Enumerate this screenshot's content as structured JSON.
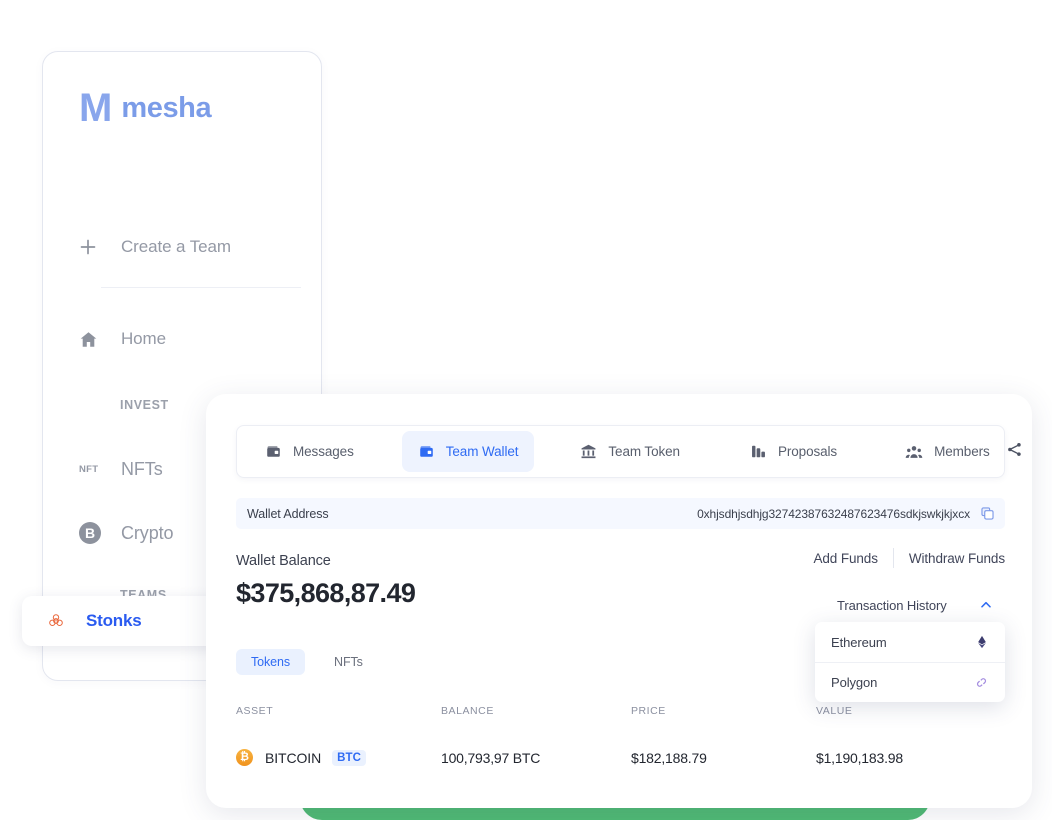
{
  "brand": {
    "mark": "M",
    "name": "mesha",
    "color": "#7b9ce8"
  },
  "sidebar": {
    "create_team": {
      "label": "Create a Team",
      "icon": "plus-icon"
    },
    "home": {
      "label": "Home",
      "icon": "home-icon"
    },
    "sections": [
      {
        "key": "invest",
        "label": "INVEST"
      },
      {
        "key": "teams",
        "label": "TEAMS"
      }
    ],
    "invest_items": [
      {
        "label": "NFTs",
        "icon": "nft-icon",
        "badge": "NFT"
      },
      {
        "label": "Crypto",
        "icon": "bitcoin-icon",
        "badge": "B"
      }
    ],
    "team_items": [
      {
        "label": "Stonks",
        "icon": "stonks-icon",
        "active": true,
        "color": "#2a5bf0"
      }
    ]
  },
  "tabs": [
    {
      "key": "messages",
      "label": "Messages",
      "icon": "wallet-icon",
      "active": false
    },
    {
      "key": "team-wallet",
      "label": "Team Wallet",
      "icon": "wallet-icon",
      "active": true
    },
    {
      "key": "team-token",
      "label": "Team Token",
      "icon": "bank-icon",
      "active": false
    },
    {
      "key": "proposals",
      "label": "Proposals",
      "icon": "proposals-icon",
      "active": false
    },
    {
      "key": "members",
      "label": "Members",
      "icon": "members-icon",
      "active": false
    }
  ],
  "share": {
    "icon": "share-icon"
  },
  "wallet": {
    "address_label": "Wallet Address",
    "address_value": "0xhjsdhjsdhjg32742387632487623476sdkjswkjkjxcx",
    "copy_icon": "copy-icon",
    "balance_label": "Wallet Balance",
    "balance_amount": "$375,868,87.49",
    "add_funds": "Add Funds",
    "withdraw_funds": "Withdraw Funds"
  },
  "transaction_history": {
    "label": "Transaction History",
    "caret": "chevron-up-icon",
    "expanded": true,
    "options": [
      {
        "label": "Ethereum",
        "icon": "ethereum-icon",
        "color": "#3c3c6e"
      },
      {
        "label": "Polygon",
        "icon": "polygon-icon",
        "color": "#a徒"
      }
    ]
  },
  "asset_toggle": [
    {
      "key": "tokens",
      "label": "Tokens",
      "active": true
    },
    {
      "key": "nfts",
      "label": "NFTs",
      "active": false
    }
  ],
  "table": {
    "headers": [
      "ASSET",
      "BALANCE",
      "PRICE",
      "VALUE"
    ],
    "rows": [
      {
        "asset_icon": "bitcoin-coin-icon",
        "asset_name": "BITCOIN",
        "asset_symbol": "BTC",
        "balance": "100,793,97 BTC",
        "price": "$182,188.79",
        "value": "$1,190,183.98"
      }
    ]
  },
  "accent": {
    "blue": "#2f6bf3",
    "green": "#4fba74",
    "orange": "#f0921d"
  }
}
